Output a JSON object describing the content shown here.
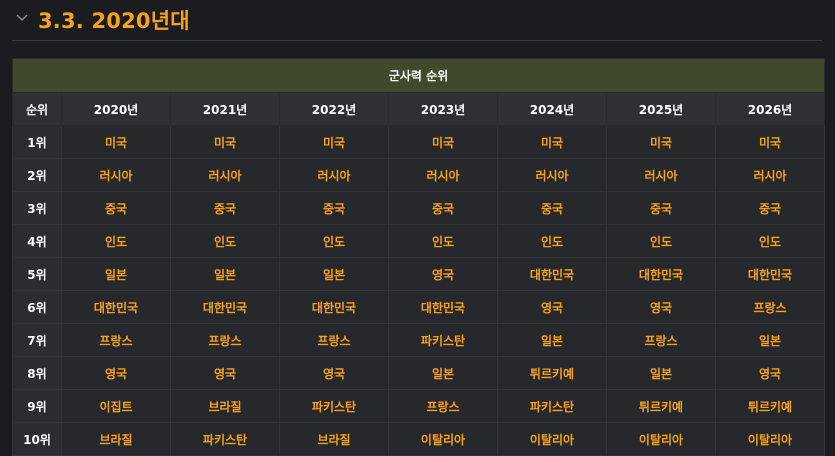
{
  "section": {
    "title": "3.3. 2020년대",
    "chevron_icon": "chevron-down-icon"
  },
  "table": {
    "title": "군사력 순위",
    "headers": [
      "순위",
      "2020년",
      "2021년",
      "2022년",
      "2023년",
      "2024년",
      "2025년",
      "2026년"
    ],
    "rows": [
      [
        "1위",
        "미국",
        "미국",
        "미국",
        "미국",
        "미국",
        "미국",
        "미국"
      ],
      [
        "2위",
        "러시아",
        "러시아",
        "러시아",
        "러시아",
        "러시아",
        "러시아",
        "러시아"
      ],
      [
        "3위",
        "중국",
        "중국",
        "중국",
        "중국",
        "중국",
        "중국",
        "중국"
      ],
      [
        "4위",
        "인도",
        "인도",
        "인도",
        "인도",
        "인도",
        "인도",
        "인도"
      ],
      [
        "5위",
        "일본",
        "일본",
        "일본",
        "영국",
        "대한민국",
        "대한민국",
        "대한민국"
      ],
      [
        "6위",
        "대한민국",
        "대한민국",
        "대한민국",
        "대한민국",
        "영국",
        "영국",
        "프랑스"
      ],
      [
        "7위",
        "프랑스",
        "프랑스",
        "프랑스",
        "파키스탄",
        "일본",
        "프랑스",
        "일본"
      ],
      [
        "8위",
        "영국",
        "영국",
        "영국",
        "일본",
        "튀르키예",
        "일본",
        "영국"
      ],
      [
        "9위",
        "이집트",
        "브라질",
        "파키스탄",
        "프랑스",
        "파키스탄",
        "튀르키예",
        "튀르키예"
      ],
      [
        "10위",
        "브라질",
        "파키스탄",
        "브라질",
        "이탈리아",
        "이탈리아",
        "이탈리아",
        "이탈리아"
      ]
    ]
  },
  "colors": {
    "accent": "#f7a21e",
    "title_bar": "#3f4a2d",
    "background": "#1b1c1f"
  }
}
